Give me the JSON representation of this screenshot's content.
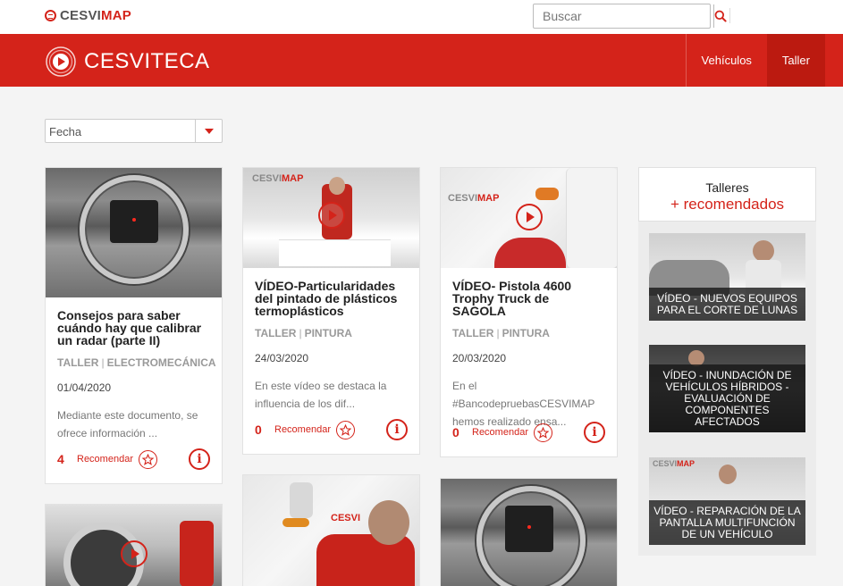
{
  "topbar": {
    "brand_a": "CESVI",
    "brand_b": "MAP",
    "search_placeholder": "Buscar"
  },
  "header": {
    "logo_text": "CESVITECA",
    "nav": [
      {
        "label": "Vehículos",
        "active": false
      },
      {
        "label": "Taller",
        "active": true
      }
    ]
  },
  "filter": {
    "selected": "Fecha"
  },
  "cards": [
    {
      "title": "Consejos para saber cuándo hay que calibrar un radar (parte II)",
      "tags": [
        "TALLER",
        "ELECTROMECÁNICA"
      ],
      "date": "01/04/2020",
      "excerpt": "Mediante este documento, se ofrece información ...",
      "count": "4",
      "recommend_label": "Recomendar",
      "image": "radar-photo"
    },
    {
      "title": "VÍDEO-Particularidades del pintado de plásticos termoplásticos",
      "tags": [
        "TALLER",
        "PINTURA"
      ],
      "date": "24/03/2020",
      "excerpt": "En este vídeo se destaca la influencia de los dif...",
      "count": "0",
      "recommend_label": "Recomendar",
      "image": "studio-video"
    },
    {
      "title": "VÍDEO- Pistola 4600 Trophy Truck de SAGOLA",
      "tags": [
        "TALLER",
        "PINTURA"
      ],
      "date": "20/03/2020",
      "excerpt": "En el #BancodepruebasCESVIMAP hemos realizado ensa...",
      "count": "0",
      "recommend_label": "Recomendar",
      "image": "spray-gun-video"
    }
  ],
  "lower_cards": [
    {
      "image": "truck-wheel-photo"
    },
    {
      "image": "spray-painter-photo",
      "brand": "CESVI"
    },
    {
      "image": "radar-photo"
    }
  ],
  "sidebar": {
    "heading_a": "Talleres",
    "heading_b": "+ recomendados",
    "tiles": [
      {
        "caption": "VÍDEO - NUEVOS EQUIPOS PARA EL CORTE DE LUNAS"
      },
      {
        "caption": "VÍDEO - INUNDACIÓN DE VEHÍCULOS HÍBRIDOS - EVALUACIÓN DE COMPONENTES AFECTADOS"
      },
      {
        "caption": "VÍDEO - REPARACIÓN DE LA PANTALLA MULTIFUNCIÓN DE UN VEHÍCULO"
      }
    ]
  },
  "colors": {
    "brand_red": "#d4231a",
    "nav_active": "#bb1a10",
    "page_bg": "#f4f4f4"
  },
  "icons": [
    "search-icon",
    "chevron-down-icon",
    "star-icon",
    "info-icon",
    "play-icon"
  ]
}
